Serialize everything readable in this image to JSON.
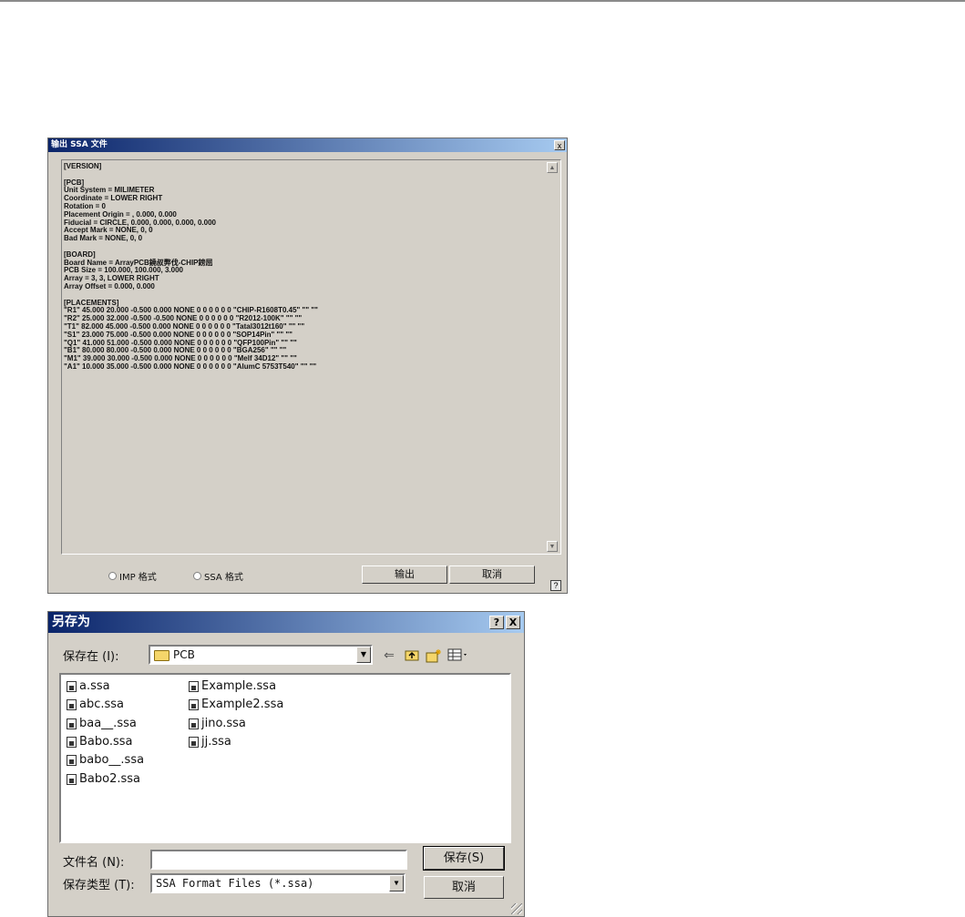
{
  "export_dialog": {
    "title": "输出 SSA 文件",
    "close_label": "x",
    "content_lines": [
      "[VERSION]",
      "",
      "[PCB]",
      "Unit System = MILIMETER",
      "Coordinate = LOWER RIGHT",
      "Rotation = 0",
      "Placement Origin = , 0.000, 0.000",
      "Fiducial = CIRCLE, 0.000, 0.000, 0.000, 0.000",
      "Accept Mark = NONE, 0, 0",
      "Bad Mark = NONE, 0, 0",
      "",
      "[BOARD]",
      "Board Name = ArrayPCB鐃叔弊伐-CHIP鎊屈",
      "PCB Size = 100.000, 100.000, 3.000",
      "Array = 3, 3, LOWER RIGHT",
      "Array Offset = 0.000, 0.000",
      "",
      "[PLACEMENTS]",
      "\"R1\" 45.000 20.000 -0.500 0.000 NONE 0 0 0 0 0 0 \"CHIP-R1608T0.45\" \"\" \"\"",
      "\"R2\" 25.000 32.000 -0.500 -0.500 NONE 0 0 0 0 0 0 \"R2012-100K\" \"\" \"\"",
      "\"T1\" 82.000 45.000 -0.500 0.000 NONE 0 0 0 0 0 0 \"Tatal3012t160\" \"\" \"\"",
      "\"S1\" 23.000 75.000 -0.500 0.000 NONE 0 0 0 0 0 0 \"SOP14Pin\" \"\" \"\"",
      "\"Q1\" 41.000 51.000 -0.500 0.000 NONE 0 0 0 0 0 0 \"QFP100Pin\" \"\" \"\"",
      "\"B1\" 80.000 80.000 -0.500 0.000 NONE 0 0 0 0 0 0 \"BGA256\" \"\" \"\"",
      "\"M1\" 39.000 30.000 -0.500 0.000 NONE 0 0 0 0 0 0 \"Melf 34D12\" \"\" \"\"",
      "\"A1\" 10.000 35.000 -0.500 0.000 NONE 0 0 0 0 0 0 \"AlumC 5753T540\" \"\" \"\""
    ],
    "radio_imp_label": "IMP 格式",
    "radio_ssa_label": "SSA 格式",
    "output_button": "输出",
    "cancel_button": "取消",
    "help_label": "?",
    "scroll_up": "▲",
    "scroll_down": "▼"
  },
  "save_dialog": {
    "title": "另存为",
    "help_label": "?",
    "close_label": "X",
    "save_in_label": "保存在 (I):",
    "save_in_value": "PCB",
    "files_col1": [
      "a.ssa",
      "abc.ssa",
      "baa__.ssa",
      "Babo.ssa",
      "babo__.ssa",
      "Babo2.ssa"
    ],
    "files_col2": [
      "Example.ssa",
      "Example2.ssa",
      "jino.ssa",
      "jj.ssa"
    ],
    "filename_label": "文件名 (N):",
    "filename_value": "",
    "filetype_label": "保存类型 (T):",
    "filetype_value": "SSA Format Files (*.ssa)",
    "save_button": "保存(S)",
    "cancel_button": "取消",
    "icons": [
      "back-arrow-icon",
      "up-folder-icon",
      "new-folder-icon",
      "view-menu-icon"
    ]
  }
}
